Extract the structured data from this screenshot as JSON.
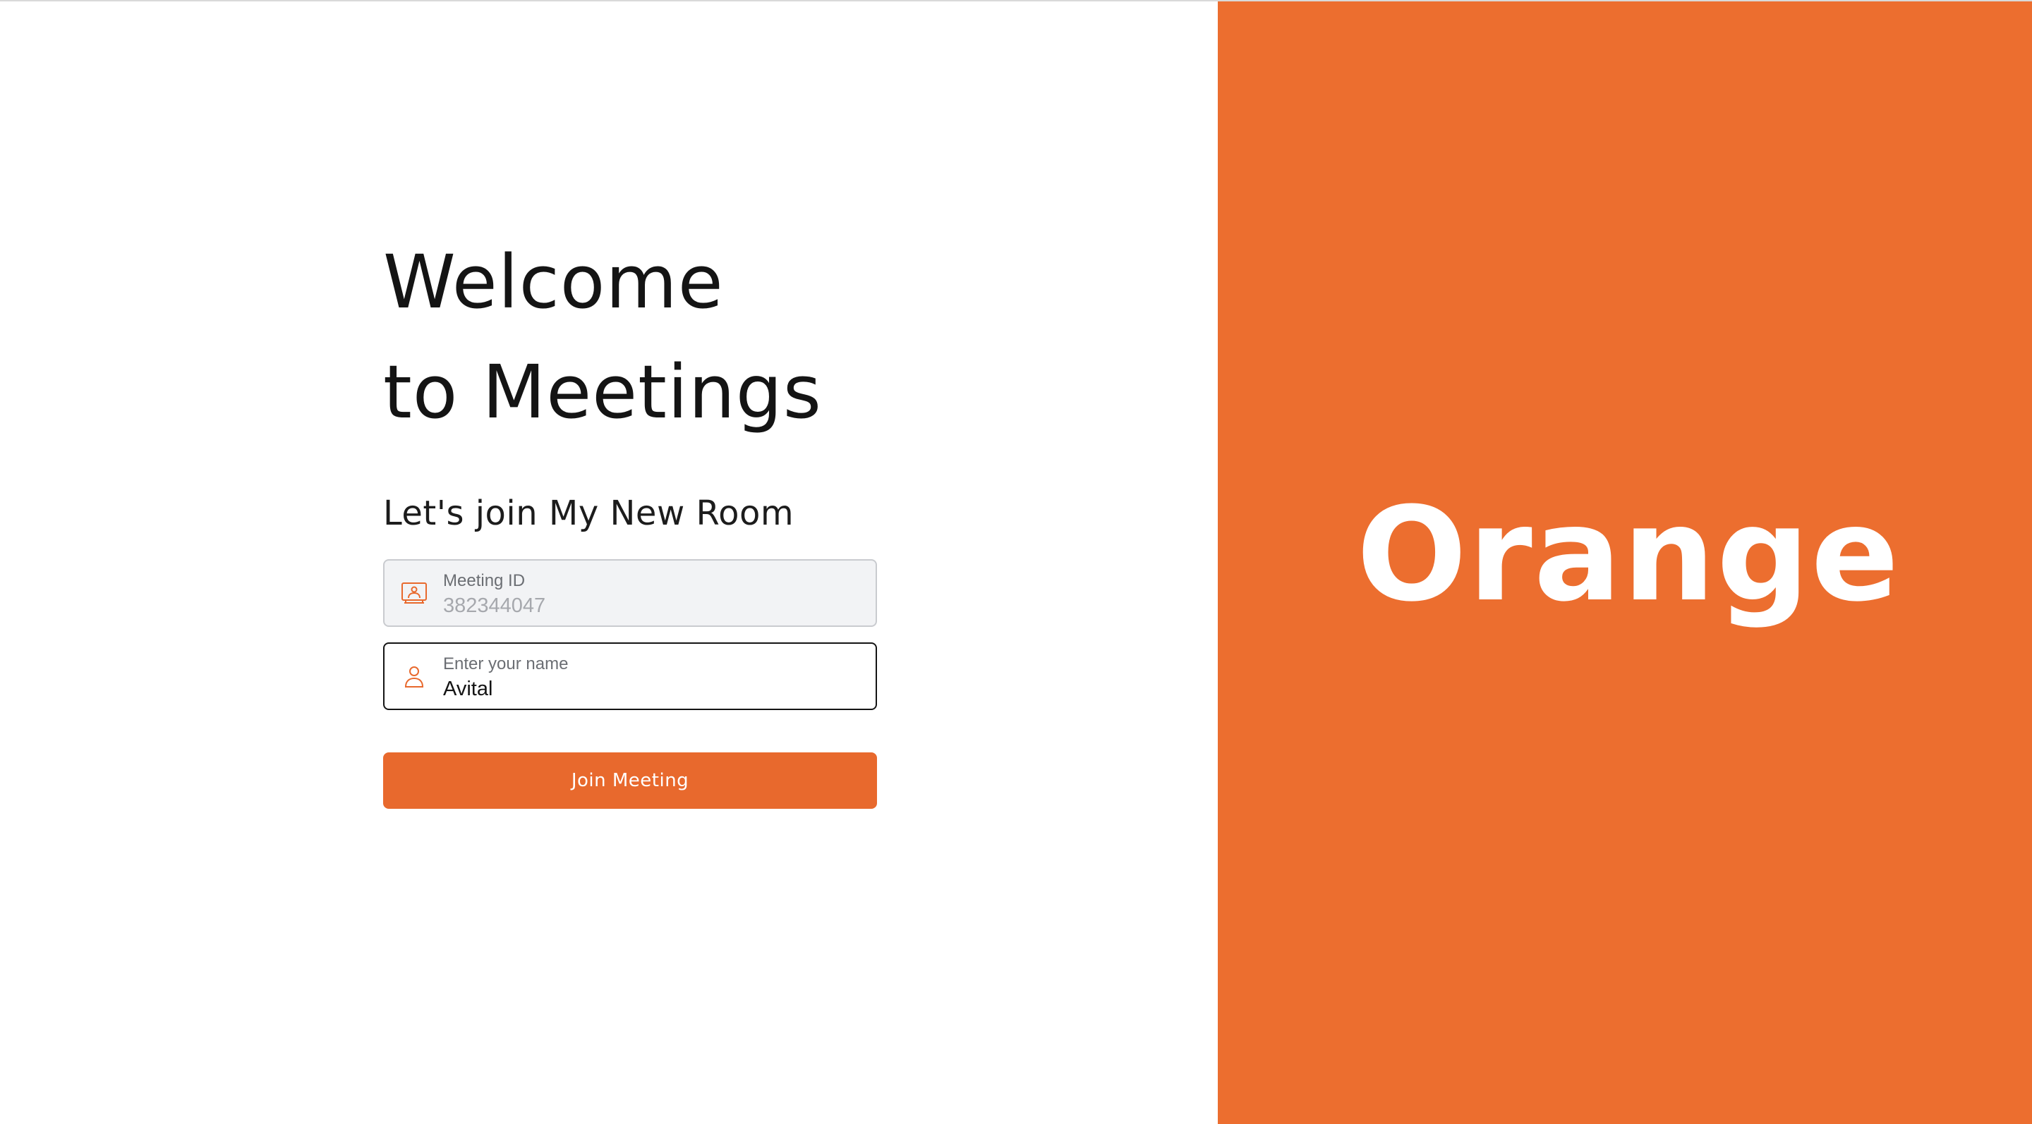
{
  "welcome": {
    "line1": "Welcome",
    "line2": "to Meetings"
  },
  "subtitle": "Let's join My New Room",
  "meeting_id_field": {
    "label": "Meeting ID",
    "value": "382344047",
    "icon": "meeting-room-icon"
  },
  "name_field": {
    "label": "Enter your name",
    "value": "Avital",
    "icon": "person-icon"
  },
  "join_button": {
    "label": "Join Meeting"
  },
  "brand": {
    "wordmark": "Orange"
  },
  "colors": {
    "accent": "#e8692d",
    "brand_panel": "#ec6e2f",
    "disabled_field_bg": "#f2f3f5"
  }
}
